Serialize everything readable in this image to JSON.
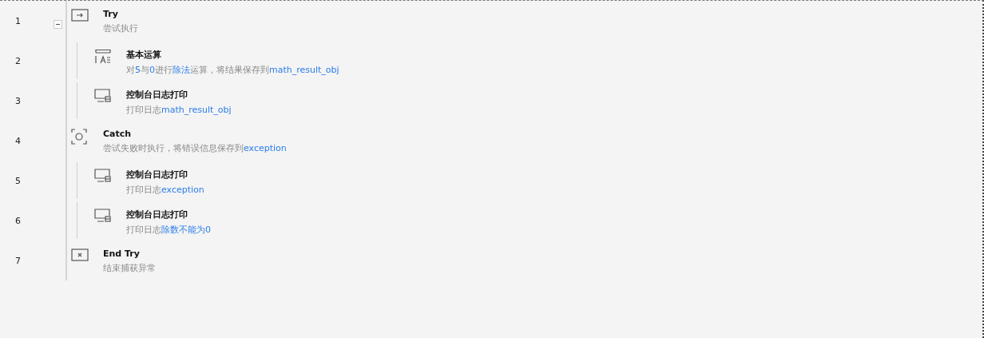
{
  "steps": [
    {
      "line": "1",
      "kind": "try",
      "title": "Try",
      "expanded": true,
      "description": [
        {
          "text": "尝试执行",
          "highlight": false
        }
      ],
      "children": [
        {
          "line": "2",
          "kind": "math",
          "title": "基本运算",
          "description": [
            {
              "text": "对",
              "highlight": false
            },
            {
              "text": "5",
              "highlight": true
            },
            {
              "text": "与",
              "highlight": false
            },
            {
              "text": "0",
              "highlight": true
            },
            {
              "text": "进行",
              "highlight": false
            },
            {
              "text": "除法",
              "highlight": true
            },
            {
              "text": "运算，将结果保存到",
              "highlight": false
            },
            {
              "text": "math_result_obj",
              "highlight": true
            }
          ]
        },
        {
          "line": "3",
          "kind": "print",
          "title": "控制台日志打印",
          "description": [
            {
              "text": "打印日志",
              "highlight": false
            },
            {
              "text": "math_result_obj",
              "highlight": true
            }
          ]
        }
      ]
    },
    {
      "line": "4",
      "kind": "catch",
      "title": "Catch",
      "description": [
        {
          "text": "尝试失败时执行，将错误信息保存到",
          "highlight": false
        },
        {
          "text": "exception",
          "highlight": true
        }
      ],
      "children": [
        {
          "line": "5",
          "kind": "print",
          "title": "控制台日志打印",
          "description": [
            {
              "text": "打印日志",
              "highlight": false
            },
            {
              "text": "exception",
              "highlight": true
            }
          ]
        },
        {
          "line": "6",
          "kind": "print",
          "title": "控制台日志打印",
          "description": [
            {
              "text": "打印日志",
              "highlight": false
            },
            {
              "text": "除数不能为0",
              "highlight": true
            }
          ]
        }
      ]
    },
    {
      "line": "7",
      "kind": "endtry",
      "title": "End Try",
      "description": [
        {
          "text": "结束捕获异常",
          "highlight": false
        }
      ]
    }
  ]
}
